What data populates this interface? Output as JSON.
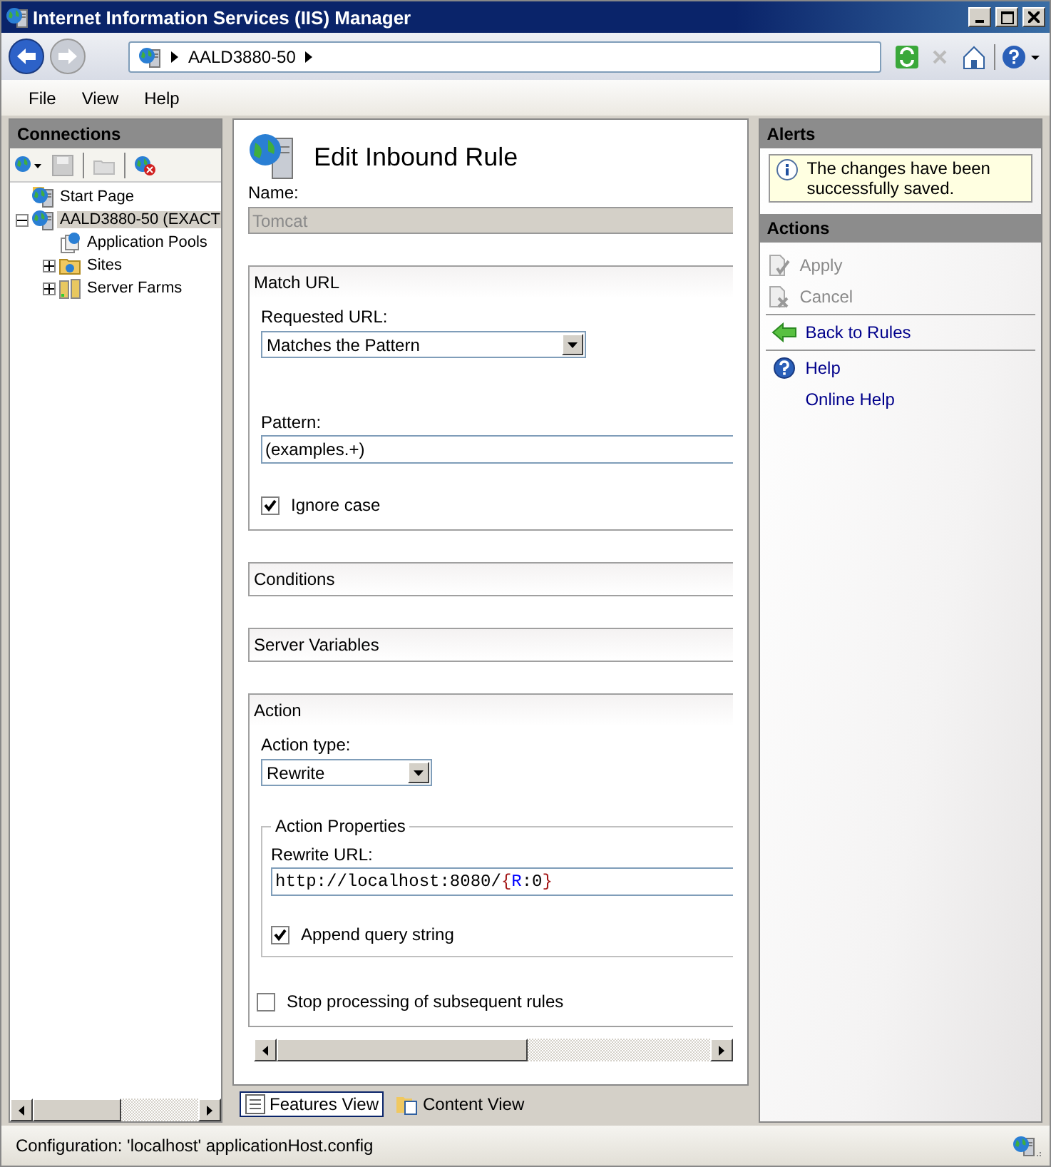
{
  "window": {
    "title": "Internet Information Services (IIS) Manager"
  },
  "address_bar": {
    "path": [
      "AALD3880-50"
    ]
  },
  "menu": [
    {
      "label": "File"
    },
    {
      "label": "View"
    },
    {
      "label": "Help"
    }
  ],
  "connections": {
    "title": "Connections",
    "tree": [
      {
        "label": "Start Page",
        "kind": "start",
        "selected": false
      },
      {
        "label": "AALD3880-50 (EXACT",
        "kind": "server",
        "selected": true,
        "expanded": true,
        "children": [
          {
            "label": "Application Pools",
            "kind": "pools",
            "selected": false
          },
          {
            "label": "Sites",
            "kind": "sites",
            "selected": false,
            "expanded": false
          },
          {
            "label": "Server Farms",
            "kind": "farms",
            "selected": false,
            "expanded": false
          }
        ]
      }
    ]
  },
  "editor": {
    "title": "Edit Inbound Rule",
    "name": {
      "label": "Name:",
      "value": "Tomcat",
      "disabled": true
    },
    "match_url": {
      "title": "Match URL",
      "requested_url": {
        "label": "Requested URL:",
        "value": "Matches the Pattern"
      },
      "pattern": {
        "label": "Pattern:",
        "value": "(examples.+)"
      },
      "ignore_case": {
        "label": "Ignore case",
        "checked": true
      }
    },
    "collapsed_sections": [
      {
        "title": "Conditions"
      },
      {
        "title": "Server Variables"
      }
    ],
    "action": {
      "title": "Action",
      "action_type": {
        "label": "Action type:",
        "value": "Rewrite"
      },
      "properties": {
        "title": "Action Properties",
        "rewrite_url": {
          "label": "Rewrite URL:",
          "value_parts": [
            {
              "text": "http://localhost:8080/",
              "kind": "plain"
            },
            {
              "text": "{",
              "kind": "brace"
            },
            {
              "text": "R",
              "kind": "variable"
            },
            {
              "text": ":0",
              "kind": "plain"
            },
            {
              "text": "}",
              "kind": "brace"
            }
          ]
        },
        "append_query": {
          "label": "Append query string",
          "checked": true
        }
      },
      "stop_processing": {
        "label": "Stop processing of subsequent rules",
        "checked": false
      }
    }
  },
  "view_tabs": [
    {
      "label": "Features View",
      "kind": "features",
      "selected": true
    },
    {
      "label": "Content View",
      "kind": "content",
      "selected": false
    }
  ],
  "alerts": {
    "title": "Alerts",
    "message": "The changes have been successfully saved."
  },
  "actions": {
    "title": "Actions",
    "groups": [
      [
        {
          "label": "Apply",
          "kind": "apply",
          "disabled": true
        },
        {
          "label": "Cancel",
          "kind": "cancel",
          "disabled": true
        }
      ],
      [
        {
          "label": "Back to Rules",
          "kind": "back",
          "disabled": false
        }
      ],
      [
        {
          "label": "Help",
          "kind": "help",
          "disabled": false
        },
        {
          "label": "Online Help",
          "kind": "none",
          "disabled": false
        }
      ]
    ]
  },
  "status_bar": {
    "text": "Configuration: 'localhost' applicationHost.config"
  }
}
